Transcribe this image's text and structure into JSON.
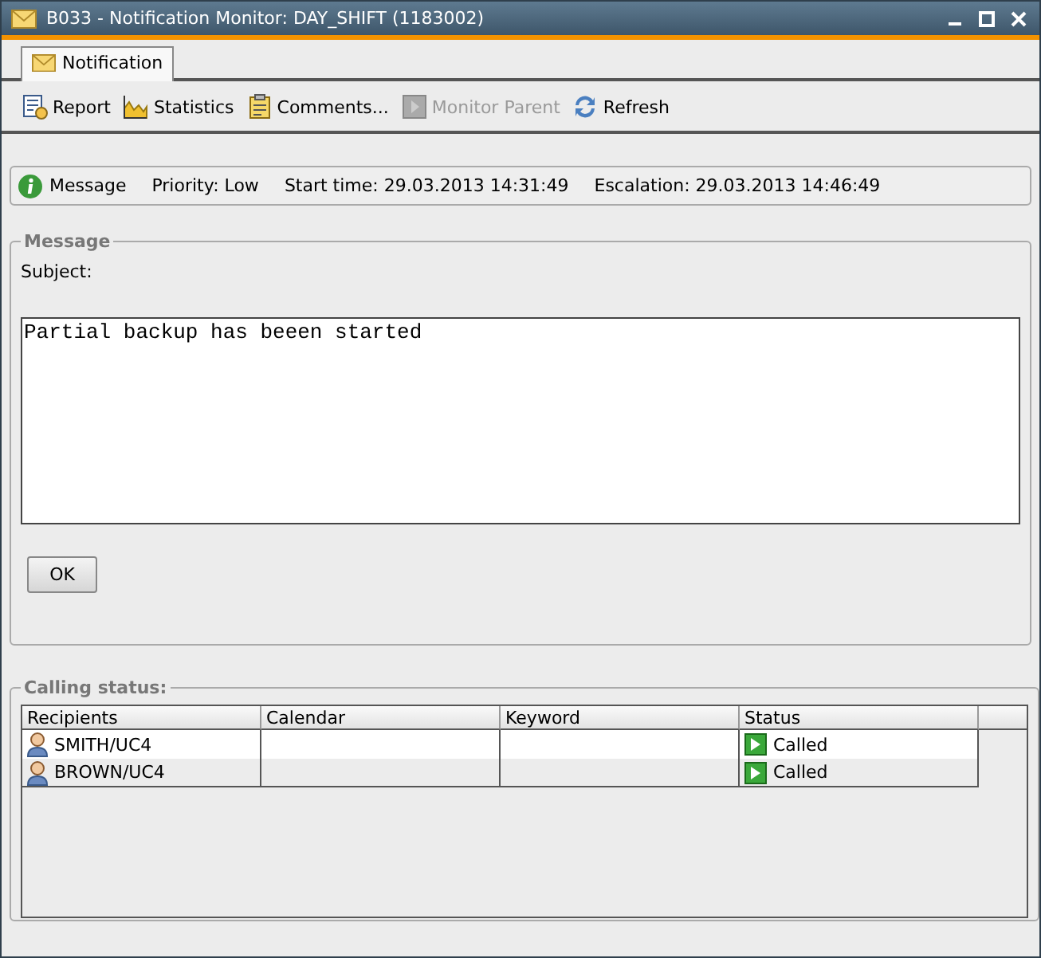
{
  "window": {
    "title": "B033 - Notification Monitor: DAY_SHIFT (1183002)"
  },
  "tabs": [
    {
      "label": "Notification",
      "selected": true
    }
  ],
  "toolbar": [
    {
      "kind": "report",
      "label": "Report",
      "disabled": false
    },
    {
      "kind": "statistics",
      "label": "Statistics",
      "disabled": false
    },
    {
      "kind": "comments",
      "label": "Comments...",
      "disabled": false
    },
    {
      "kind": "monitor",
      "label": "Monitor Parent",
      "disabled": true
    },
    {
      "kind": "refresh",
      "label": "Refresh",
      "disabled": false
    }
  ],
  "info_bar": {
    "type": "Message",
    "priority": "Priority: Low",
    "start_time": "Start time: 29.03.2013 14:31:49",
    "escalation": "Escalation: 29.03.2013 14:46:49"
  },
  "message": {
    "legend": "Message",
    "subject_label": "Subject:",
    "body": "Partial backup has beeen started",
    "ok_button": "OK"
  },
  "calling_status": {
    "legend": "Calling status:",
    "columns": [
      "Recipients",
      "Calendar",
      "Keyword",
      "Status"
    ],
    "rows": [
      {
        "recipient": "SMITH/UC4",
        "calendar": "",
        "keyword": "",
        "status": "Called"
      },
      {
        "recipient": "BROWN/UC4",
        "calendar": "",
        "keyword": "",
        "status": "Called"
      }
    ]
  }
}
